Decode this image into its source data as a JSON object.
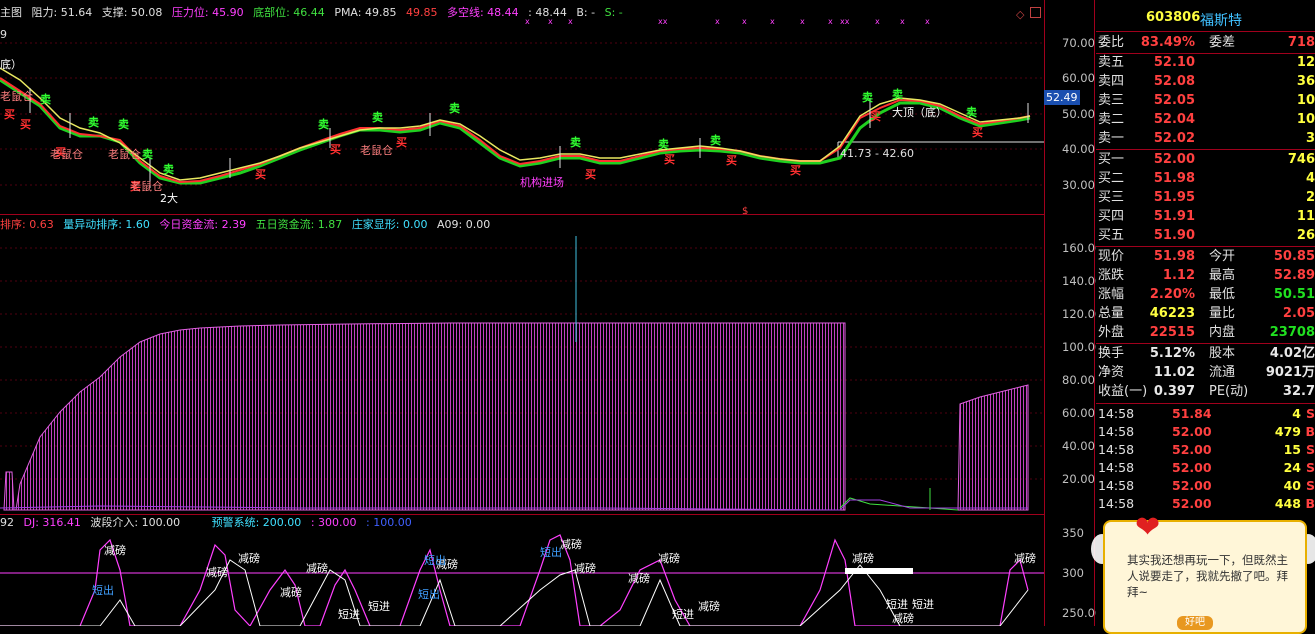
{
  "main_header": {
    "title": "主图",
    "items": [
      {
        "text": "阻力: 51.64",
        "color": "#e0e0e0"
      },
      {
        "text": "支撑: 50.08",
        "color": "#e0e0e0"
      },
      {
        "text": "压力位: 45.90",
        "color": "#ff40ff"
      },
      {
        "text": "底部位: 46.44",
        "color": "#40e040"
      },
      {
        "text": "PMA: 49.85",
        "color": "#e0e0e0"
      },
      {
        "text": "49.85",
        "color": "#ff4040"
      },
      {
        "text": "多空线: 48.44",
        "color": "#ff40ff"
      },
      {
        "text": ": 48.44",
        "color": "#e0e0e0"
      },
      {
        "text": "B: -",
        "color": "#e0e0e0"
      },
      {
        "text": "S: -",
        "color": "#40e040"
      }
    ],
    "left_stub": "9"
  },
  "main_chart": {
    "y_ticks": [
      "70.00",
      "60.00",
      "50.00",
      "40.00",
      "30.00"
    ],
    "current_price_tag": "52.49",
    "range_label": "41.73 - 42.60",
    "annotations": [
      {
        "text": "底）",
        "color": "#ffffff"
      },
      {
        "text": "老鼠仓",
        "color": "#ff8080"
      },
      {
        "text": "老鼠仓",
        "color": "#ff8080"
      },
      {
        "text": "老鼠仓",
        "color": "#ff8080"
      },
      {
        "text": "老鼠仓",
        "color": "#ff8080"
      },
      {
        "text": "老鼠仓",
        "color": "#ff8080"
      },
      {
        "text": "机构进场",
        "color": "#ff40ff"
      },
      {
        "text": "大顶（底）",
        "color": "#ffffff"
      },
      {
        "text": "2大",
        "color": "#ffffff"
      }
    ],
    "buy_marker": "卖",
    "sell_marker": "买"
  },
  "volume_header": {
    "items": [
      {
        "text": "排序: 0.63",
        "color": "#ff4040"
      },
      {
        "text": "量异动排序: 1.60",
        "color": "#40e0ff"
      },
      {
        "text": "今日资金流: 2.39",
        "color": "#ff40ff"
      },
      {
        "text": "五日资金流: 1.87",
        "color": "#40e040"
      },
      {
        "text": "庄家显形: 0.00",
        "color": "#40e0ff"
      },
      {
        "text": "A09: 0.00",
        "color": "#e0e0e0"
      }
    ],
    "y_ticks": [
      "160.00",
      "140.00",
      "120.00",
      "100.00",
      "80.00",
      "60.00",
      "40.00",
      "20.00"
    ]
  },
  "indicator_header": {
    "items": [
      {
        "text": "92",
        "color": "#e0e0e0"
      },
      {
        "text": "DJ: 316.41",
        "color": "#ff40ff"
      },
      {
        "text": "波段介入: 100.00",
        "color": "#e0e0e0"
      },
      {
        "text": "预警系统: 200.00",
        "color": "#40e0ff"
      },
      {
        "text": ": 300.00",
        "color": "#ff40ff"
      },
      {
        "text": ": 100.00",
        "color": "#4060ff"
      }
    ],
    "y_ticks": [
      "350",
      "300",
      "250.00"
    ],
    "labels": [
      {
        "text": "减磅",
        "color": "#ffffff"
      },
      {
        "text": "短出",
        "color": "#40a0ff"
      },
      {
        "text": "短进",
        "color": "#ffffff"
      }
    ]
  },
  "quote_panel": {
    "code": "603806",
    "name": "福斯特",
    "weibi_label": "委比",
    "weibi_value": "83.49%",
    "weicha_label": "委差",
    "weicha_value": "718",
    "sells": [
      {
        "label": "卖五",
        "price": "52.10",
        "vol": "12"
      },
      {
        "label": "卖四",
        "price": "52.08",
        "vol": "36"
      },
      {
        "label": "卖三",
        "price": "52.05",
        "vol": "10"
      },
      {
        "label": "卖二",
        "price": "52.04",
        "vol": "10"
      },
      {
        "label": "卖一",
        "price": "52.02",
        "vol": "3"
      }
    ],
    "buys": [
      {
        "label": "买一",
        "price": "52.00",
        "vol": "746"
      },
      {
        "label": "买二",
        "price": "51.98",
        "vol": "4"
      },
      {
        "label": "买三",
        "price": "51.95",
        "vol": "2"
      },
      {
        "label": "买四",
        "price": "51.91",
        "vol": "11"
      },
      {
        "label": "买五",
        "price": "51.90",
        "vol": "26"
      }
    ],
    "stats": [
      {
        "l1": "现价",
        "v1": "51.98",
        "c1": "red",
        "l2": "今开",
        "v2": "50.85",
        "c2": "red"
      },
      {
        "l1": "涨跌",
        "v1": "1.12",
        "c1": "red",
        "l2": "最高",
        "v2": "52.89",
        "c2": "red"
      },
      {
        "l1": "涨幅",
        "v1": "2.20%",
        "c1": "red",
        "l2": "最低",
        "v2": "50.51",
        "c2": "green"
      },
      {
        "l1": "总量",
        "v1": "46223",
        "c1": "yellow",
        "l2": "量比",
        "v2": "2.05",
        "c2": "red"
      },
      {
        "l1": "外盘",
        "v1": "22515",
        "c1": "red",
        "l2": "内盘",
        "v2": "23708",
        "c2": "green"
      }
    ],
    "fundamentals": [
      {
        "l1": "换手",
        "v1": "5.12%",
        "l2": "股本",
        "v2": "4.02亿"
      },
      {
        "l1": "净资",
        "v1": "11.02",
        "l2": "流通",
        "v2": "9021万"
      },
      {
        "l1": "收益(一)",
        "v1": "0.397",
        "l2": "PE(动)",
        "v2": "32.7"
      }
    ],
    "ticks": [
      {
        "time": "14:58",
        "price": "51.84",
        "vol": "4",
        "side": "S",
        "color": "green"
      },
      {
        "time": "14:58",
        "price": "52.00",
        "vol": "479",
        "side": "B",
        "color": "red"
      },
      {
        "time": "14:58",
        "price": "52.00",
        "vol": "15",
        "side": "S",
        "color": "green"
      },
      {
        "time": "14:58",
        "price": "52.00",
        "vol": "24",
        "side": "S",
        "color": "green"
      },
      {
        "time": "14:58",
        "price": "52.00",
        "vol": "40",
        "side": "S",
        "color": "green"
      },
      {
        "time": "14:58",
        "price": "52.00",
        "vol": "448",
        "side": "B",
        "color": "red"
      }
    ]
  },
  "popup": {
    "message": "其实我还想再玩一下，但既然主人说要走了，我就先撤了吧。拜拜~",
    "button": "好吧"
  }
}
